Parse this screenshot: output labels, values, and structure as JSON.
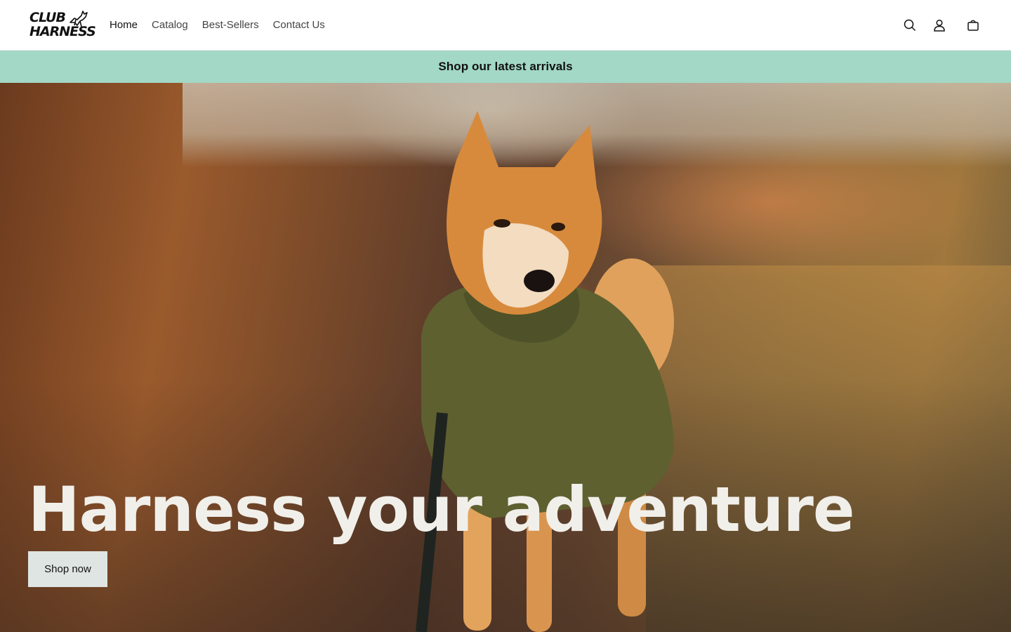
{
  "brand": {
    "logo_line1": "CLUB",
    "logo_line2": "HARNESS"
  },
  "nav": {
    "items": [
      {
        "label": "Home",
        "active": true
      },
      {
        "label": "Catalog",
        "active": false
      },
      {
        "label": "Best-Sellers",
        "active": false
      },
      {
        "label": "Contact Us",
        "active": false
      }
    ]
  },
  "header_icons": [
    "search-icon",
    "account-icon",
    "cart-icon"
  ],
  "announcement": {
    "text": "Shop our latest arrivals",
    "background": "#a2d8c5"
  },
  "hero": {
    "title": "Harness your adventure",
    "button_label": "Shop now",
    "button_background": "#dfe5e3"
  }
}
